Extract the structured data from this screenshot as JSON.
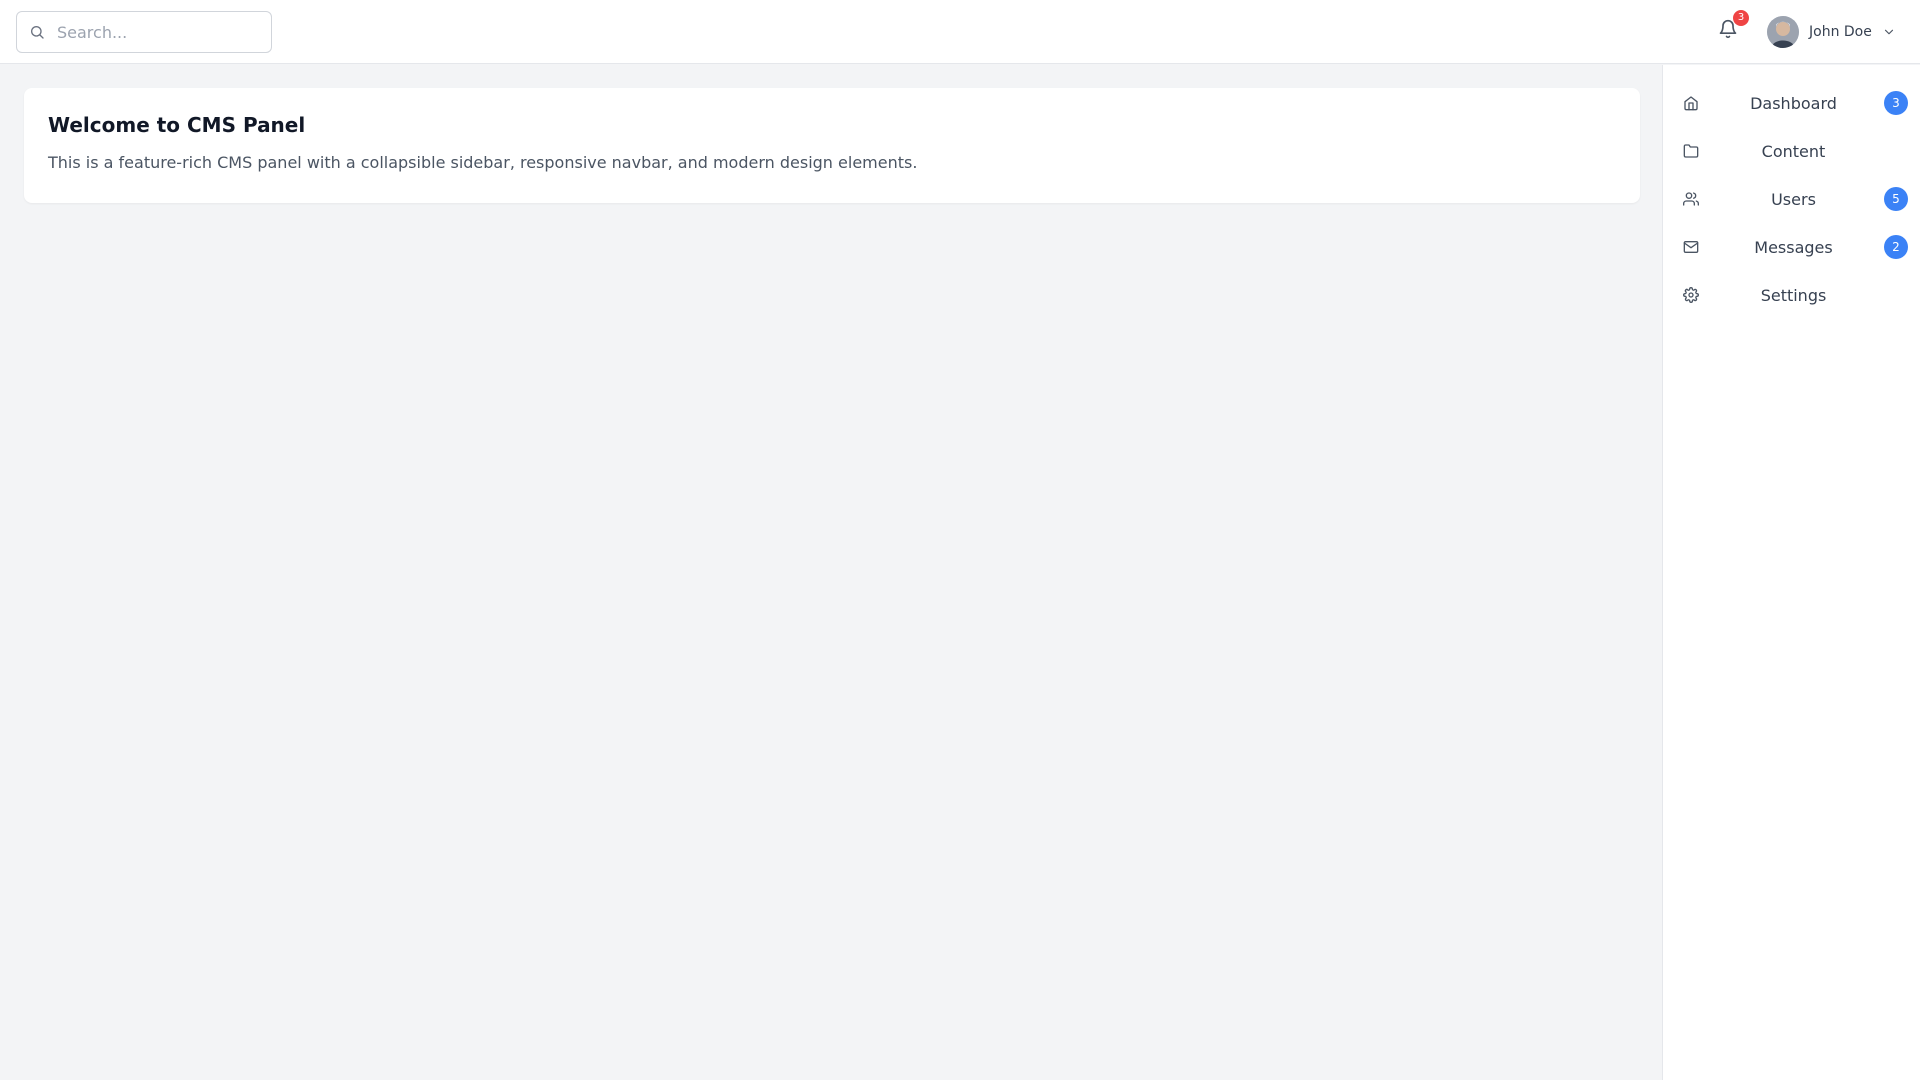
{
  "search": {
    "placeholder": "Search..."
  },
  "notifications": {
    "count": "3"
  },
  "user": {
    "name": "John Doe"
  },
  "card": {
    "title": "Welcome to CMS Panel",
    "text": "This is a feature-rich CMS panel with a collapsible sidebar, responsive navbar, and modern design elements."
  },
  "sidebar": {
    "items": [
      {
        "label": "Dashboard",
        "icon": "home-icon",
        "badge": "3"
      },
      {
        "label": "Content",
        "icon": "folder-icon",
        "badge": null
      },
      {
        "label": "Users",
        "icon": "users-icon",
        "badge": "5"
      },
      {
        "label": "Messages",
        "icon": "mail-icon",
        "badge": "2"
      },
      {
        "label": "Settings",
        "icon": "gear-icon",
        "badge": null
      }
    ]
  },
  "colors": {
    "accent": "#3b82f6",
    "notification_badge": "#ef4444",
    "background": "#f3f4f6"
  }
}
